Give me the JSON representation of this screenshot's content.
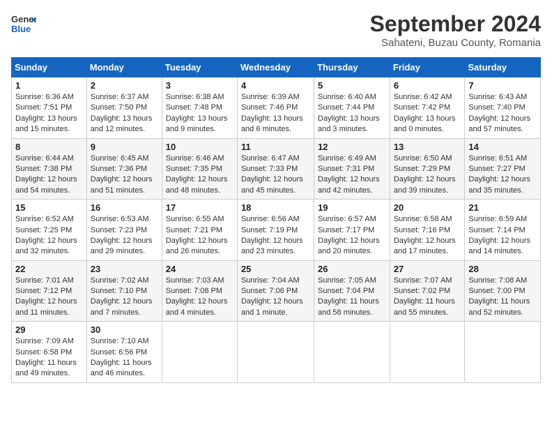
{
  "header": {
    "logo_line1": "General",
    "logo_line2": "Blue",
    "title": "September 2024",
    "subtitle": "Sahateni, Buzau County, Romania"
  },
  "weekdays": [
    "Sunday",
    "Monday",
    "Tuesday",
    "Wednesday",
    "Thursday",
    "Friday",
    "Saturday"
  ],
  "weeks": [
    [
      {
        "day": 1,
        "lines": [
          "Sunrise: 6:36 AM",
          "Sunset: 7:51 PM",
          "Daylight: 13 hours",
          "and 15 minutes."
        ]
      },
      {
        "day": 2,
        "lines": [
          "Sunrise: 6:37 AM",
          "Sunset: 7:50 PM",
          "Daylight: 13 hours",
          "and 12 minutes."
        ]
      },
      {
        "day": 3,
        "lines": [
          "Sunrise: 6:38 AM",
          "Sunset: 7:48 PM",
          "Daylight: 13 hours",
          "and 9 minutes."
        ]
      },
      {
        "day": 4,
        "lines": [
          "Sunrise: 6:39 AM",
          "Sunset: 7:46 PM",
          "Daylight: 13 hours",
          "and 6 minutes."
        ]
      },
      {
        "day": 5,
        "lines": [
          "Sunrise: 6:40 AM",
          "Sunset: 7:44 PM",
          "Daylight: 13 hours",
          "and 3 minutes."
        ]
      },
      {
        "day": 6,
        "lines": [
          "Sunrise: 6:42 AM",
          "Sunset: 7:42 PM",
          "Daylight: 13 hours",
          "and 0 minutes."
        ]
      },
      {
        "day": 7,
        "lines": [
          "Sunrise: 6:43 AM",
          "Sunset: 7:40 PM",
          "Daylight: 12 hours",
          "and 57 minutes."
        ]
      }
    ],
    [
      {
        "day": 8,
        "lines": [
          "Sunrise: 6:44 AM",
          "Sunset: 7:38 PM",
          "Daylight: 12 hours",
          "and 54 minutes."
        ]
      },
      {
        "day": 9,
        "lines": [
          "Sunrise: 6:45 AM",
          "Sunset: 7:36 PM",
          "Daylight: 12 hours",
          "and 51 minutes."
        ]
      },
      {
        "day": 10,
        "lines": [
          "Sunrise: 6:46 AM",
          "Sunset: 7:35 PM",
          "Daylight: 12 hours",
          "and 48 minutes."
        ]
      },
      {
        "day": 11,
        "lines": [
          "Sunrise: 6:47 AM",
          "Sunset: 7:33 PM",
          "Daylight: 12 hours",
          "and 45 minutes."
        ]
      },
      {
        "day": 12,
        "lines": [
          "Sunrise: 6:49 AM",
          "Sunset: 7:31 PM",
          "Daylight: 12 hours",
          "and 42 minutes."
        ]
      },
      {
        "day": 13,
        "lines": [
          "Sunrise: 6:50 AM",
          "Sunset: 7:29 PM",
          "Daylight: 12 hours",
          "and 39 minutes."
        ]
      },
      {
        "day": 14,
        "lines": [
          "Sunrise: 6:51 AM",
          "Sunset: 7:27 PM",
          "Daylight: 12 hours",
          "and 35 minutes."
        ]
      }
    ],
    [
      {
        "day": 15,
        "lines": [
          "Sunrise: 6:52 AM",
          "Sunset: 7:25 PM",
          "Daylight: 12 hours",
          "and 32 minutes."
        ]
      },
      {
        "day": 16,
        "lines": [
          "Sunrise: 6:53 AM",
          "Sunset: 7:23 PM",
          "Daylight: 12 hours",
          "and 29 minutes."
        ]
      },
      {
        "day": 17,
        "lines": [
          "Sunrise: 6:55 AM",
          "Sunset: 7:21 PM",
          "Daylight: 12 hours",
          "and 26 minutes."
        ]
      },
      {
        "day": 18,
        "lines": [
          "Sunrise: 6:56 AM",
          "Sunset: 7:19 PM",
          "Daylight: 12 hours",
          "and 23 minutes."
        ]
      },
      {
        "day": 19,
        "lines": [
          "Sunrise: 6:57 AM",
          "Sunset: 7:17 PM",
          "Daylight: 12 hours",
          "and 20 minutes."
        ]
      },
      {
        "day": 20,
        "lines": [
          "Sunrise: 6:58 AM",
          "Sunset: 7:16 PM",
          "Daylight: 12 hours",
          "and 17 minutes."
        ]
      },
      {
        "day": 21,
        "lines": [
          "Sunrise: 6:59 AM",
          "Sunset: 7:14 PM",
          "Daylight: 12 hours",
          "and 14 minutes."
        ]
      }
    ],
    [
      {
        "day": 22,
        "lines": [
          "Sunrise: 7:01 AM",
          "Sunset: 7:12 PM",
          "Daylight: 12 hours",
          "and 11 minutes."
        ]
      },
      {
        "day": 23,
        "lines": [
          "Sunrise: 7:02 AM",
          "Sunset: 7:10 PM",
          "Daylight: 12 hours",
          "and 7 minutes."
        ]
      },
      {
        "day": 24,
        "lines": [
          "Sunrise: 7:03 AM",
          "Sunset: 7:08 PM",
          "Daylight: 12 hours",
          "and 4 minutes."
        ]
      },
      {
        "day": 25,
        "lines": [
          "Sunrise: 7:04 AM",
          "Sunset: 7:06 PM",
          "Daylight: 12 hours",
          "and 1 minute."
        ]
      },
      {
        "day": 26,
        "lines": [
          "Sunrise: 7:05 AM",
          "Sunset: 7:04 PM",
          "Daylight: 11 hours",
          "and 58 minutes."
        ]
      },
      {
        "day": 27,
        "lines": [
          "Sunrise: 7:07 AM",
          "Sunset: 7:02 PM",
          "Daylight: 11 hours",
          "and 55 minutes."
        ]
      },
      {
        "day": 28,
        "lines": [
          "Sunrise: 7:08 AM",
          "Sunset: 7:00 PM",
          "Daylight: 11 hours",
          "and 52 minutes."
        ]
      }
    ],
    [
      {
        "day": 29,
        "lines": [
          "Sunrise: 7:09 AM",
          "Sunset: 6:58 PM",
          "Daylight: 11 hours",
          "and 49 minutes."
        ]
      },
      {
        "day": 30,
        "lines": [
          "Sunrise: 7:10 AM",
          "Sunset: 6:56 PM",
          "Daylight: 11 hours",
          "and 46 minutes."
        ]
      },
      null,
      null,
      null,
      null,
      null
    ]
  ]
}
